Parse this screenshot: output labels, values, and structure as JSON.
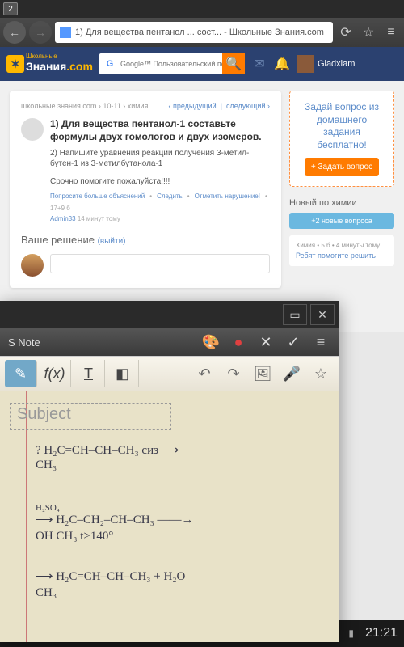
{
  "status": {
    "tab_count": "2"
  },
  "browser": {
    "page_title": "1) Для вещества пентанол ... сост... - Школьные Знания.com"
  },
  "header": {
    "logo_sub": "Школьные",
    "logo_main": "Знания",
    "logo_tld": ".com",
    "search_placeholder": "Google™ Пользовательский поиск",
    "username": "Gladxlam"
  },
  "breadcrumb": {
    "path": "школьные знания.com › 10-11 › химия",
    "prev": "‹ предыдущий",
    "next": "следующий ›"
  },
  "question": {
    "title": "1) Для вещества пентанол-1 составьте формулы двух гомологов и двух изомеров.",
    "sub": "2) Напишите уравнения реакции получения 3-метил-бутен-1 из 3-метилбутанола-1",
    "urgent": "Срочно помогите пожалуйста!!!!",
    "meta_ask": "Попросите больше объяснений",
    "meta_follow": "Следить",
    "meta_flag": "Отметить нарушение!",
    "meta_pts": "17+9 б",
    "author": "Admin33",
    "author_time": "14 минут тому"
  },
  "answer": {
    "heading": "Ваше решение",
    "logout": "(выйти)"
  },
  "sidebar": {
    "ask_text": "Задай вопрос из домашнего задания бесплатно!",
    "ask_btn": "+ Задать вопрос",
    "new_heading": "Новый по химии",
    "new_btn": "+2 новые вопроса",
    "item_cat": "Химия • 5 б • 4 минуты тому",
    "item_txt": "Ребят помогите решить"
  },
  "snote": {
    "title": "S Note",
    "subject_placeholder": "Subject",
    "hw_line1": "?  H₂C=CH–CH–CH₃  сиз ⟶",
    "hw_line1b": "              CH₃",
    "hw_line2": "⟶  H₂C–CH₂–CH–CH₃  ――→",
    "hw_line2a": "                             H₂SO₄",
    "hw_line2b": "      OH         CH₃        t>140°",
    "hw_line3": "⟶  H₂C=CH–CH–CH₃ +  H₂O",
    "hw_line3b": "                  CH₃"
  },
  "navbar": {
    "time": "21:21"
  }
}
